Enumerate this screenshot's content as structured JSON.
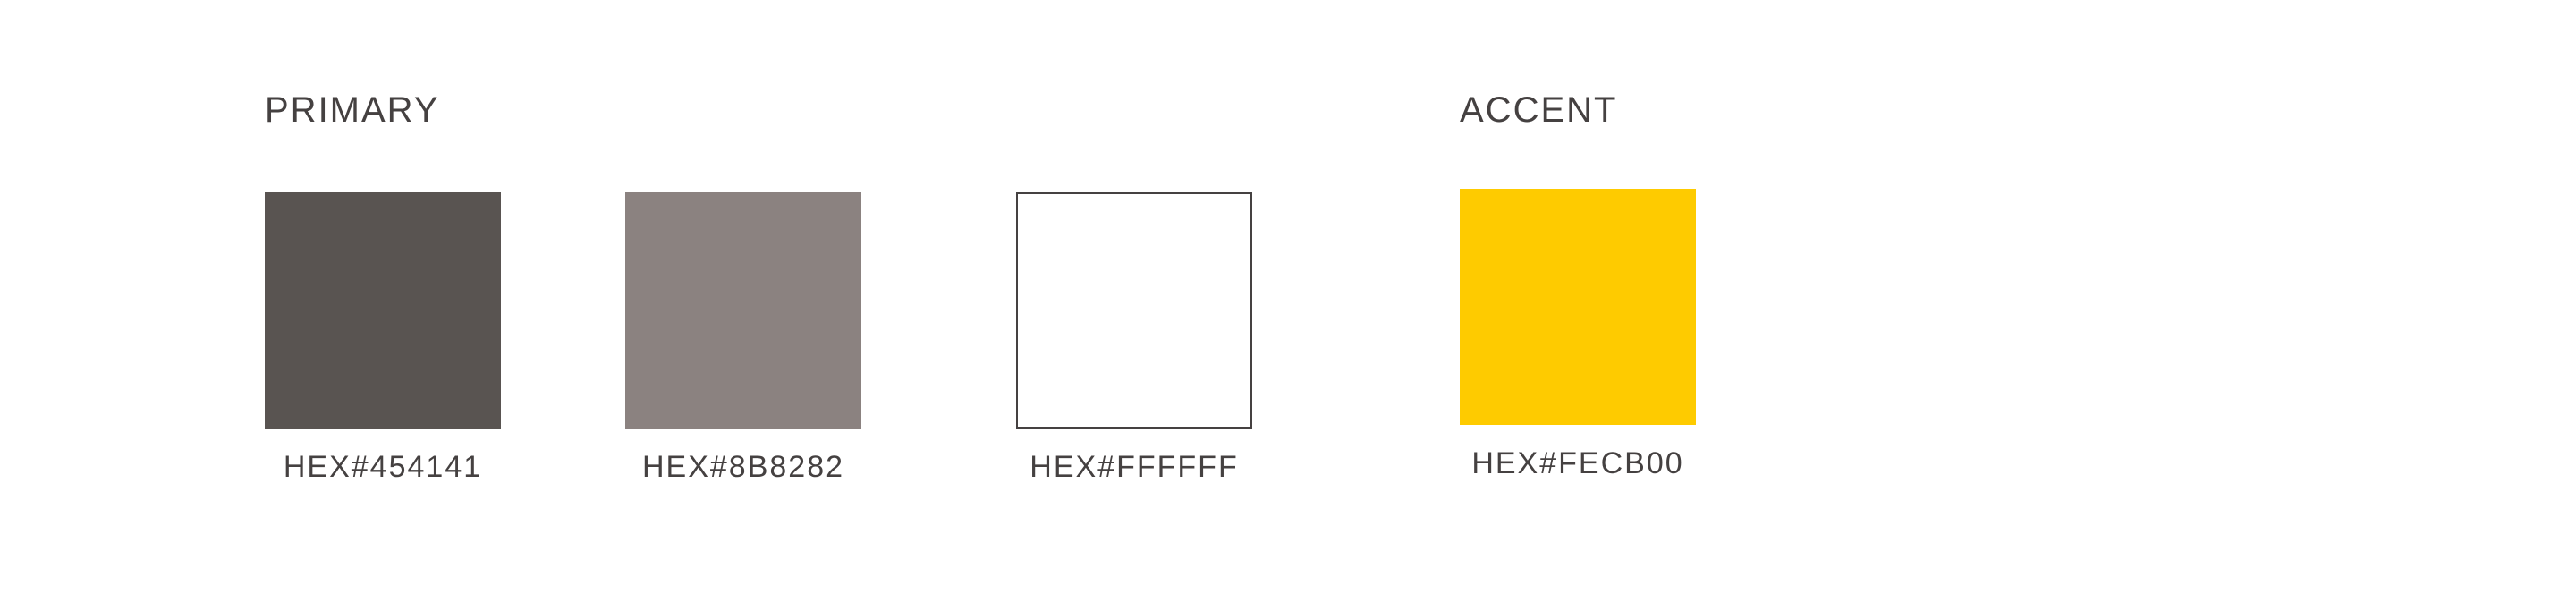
{
  "groups": {
    "primary": {
      "title": "PRIMARY",
      "swatches": [
        {
          "label": "HEX#454141",
          "color": "#595451"
        },
        {
          "label": "HEX#8B8282",
          "color": "#8B8280"
        },
        {
          "label": "HEX#FFFFFF",
          "color": "#FFFFFF",
          "outline": "#454141"
        }
      ]
    },
    "accent": {
      "title": "ACCENT",
      "swatches": [
        {
          "label": "HEX#FECB00",
          "color": "#FECB00"
        }
      ]
    }
  }
}
